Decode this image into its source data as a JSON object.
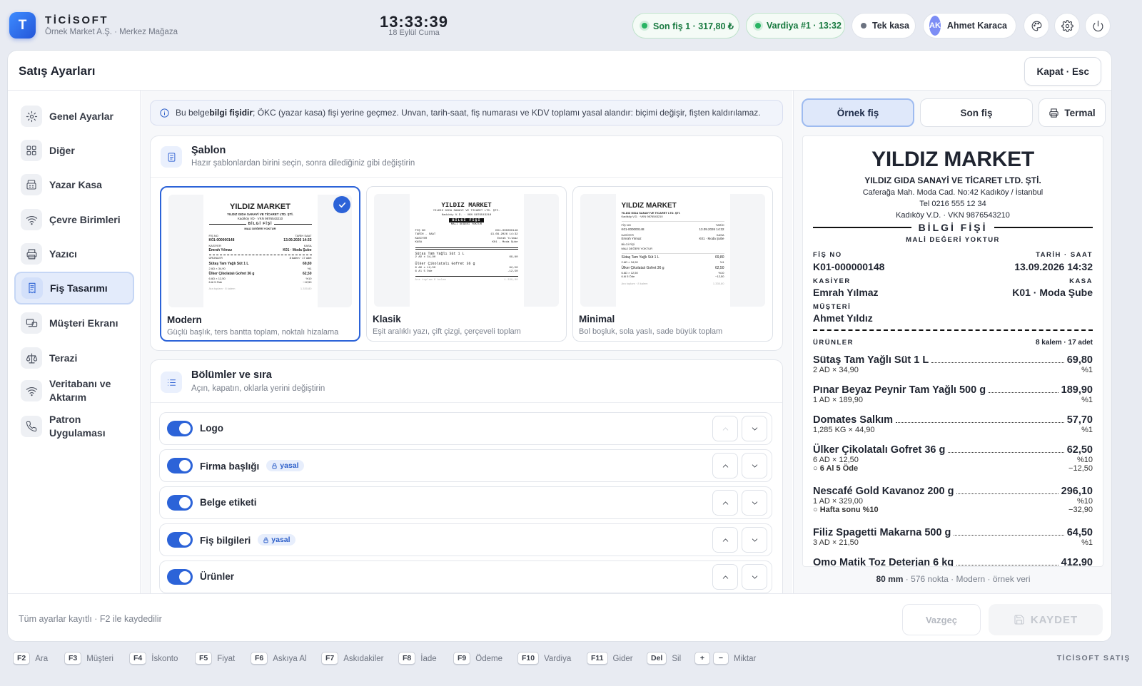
{
  "app": {
    "logo_letter": "T",
    "brand": "TİCİSOFT",
    "company": "Örnek Market A.Ş. · Merkez Mağaza",
    "clock": "13:33:39",
    "date": "18 Eylül Cuma"
  },
  "status": {
    "last_receipt": "Son fiş 1 · 317,80 ₺",
    "shift": "Vardiya #1 · 13:32",
    "register": "Tek kasa",
    "user_initials": "AK",
    "user_name": "Ahmet Karaca"
  },
  "panel": {
    "title": "Satış Ayarları",
    "close_label": "Kapat · Esc"
  },
  "sidebar": {
    "items": [
      {
        "label": "Genel Ayarlar",
        "icon": "gear-icon"
      },
      {
        "label": "Diğer",
        "icon": "grid-icon"
      },
      {
        "label": "Yazar Kasa",
        "icon": "cash-register-icon"
      },
      {
        "label": "Çevre Birimleri",
        "icon": "wifi-icon"
      },
      {
        "label": "Yazıcı",
        "icon": "printer-icon"
      },
      {
        "label": "Fiş Tasarımı",
        "icon": "receipt-icon",
        "active": true
      },
      {
        "label": "Müşteri Ekranı",
        "icon": "display-icon"
      },
      {
        "label": "Terazi",
        "icon": "scale-icon"
      },
      {
        "label": "Veritabanı ve Aktarım",
        "icon": "wifi-icon"
      },
      {
        "label": "Patron Uygulaması",
        "icon": "phone-icon"
      }
    ]
  },
  "info": {
    "pre": "Bu belge ",
    "bold": "bilgi fişidir",
    "post": "; ÖKC (yazar kasa) fişi yerine geçmez. Unvan, tarih-saat, fiş numarası ve KDV toplamı yasal alandır: biçimi değişir, fişten kaldırılamaz."
  },
  "template_card": {
    "title": "Şablon",
    "subtitle": "Hazır şablonlardan birini seçin, sonra dilediğiniz gibi değiştirin",
    "templates": [
      {
        "name": "Modern",
        "desc": "Güçlü başlık, ters bantta toplam, noktalı hizalama",
        "selected": true
      },
      {
        "name": "Klasik",
        "desc": "Eşit aralıklı yazı, çift çizgi, çerçeveli toplam",
        "selected": false
      },
      {
        "name": "Minimal",
        "desc": "Bol boşluk, sola yaslı, sade büyük toplam",
        "selected": false
      }
    ]
  },
  "sections_card": {
    "title": "Bölümler ve sıra",
    "subtitle": "Açın, kapatın, oklarla yerini değiştirin",
    "legal_badge": "yasal",
    "rows": [
      {
        "label": "Logo",
        "enabled": true,
        "legal": false
      },
      {
        "label": "Firma başlığı",
        "enabled": true,
        "legal": true
      },
      {
        "label": "Belge etiketi",
        "enabled": true,
        "legal": false
      },
      {
        "label": "Fiş bilgileri",
        "enabled": true,
        "legal": true
      },
      {
        "label": "Ürünler",
        "enabled": true,
        "legal": false
      }
    ]
  },
  "preview": {
    "tabs": [
      "Örnek fiş",
      "Son fiş",
      "Termal"
    ],
    "store": "YILDIZ MARKET",
    "legal_name": "YILDIZ GIDA SANAYİ VE TİCARET LTD. ŞTİ.",
    "address": "Caferağa Mah. Moda Cad. No:42 Kadıköy / İstanbul",
    "phone": "Tel 0216 555 12 34",
    "tax": "Kadıköy V.D. · VKN 9876543210",
    "doc_label": "BİLGİ FİŞİ",
    "doc_sub": "MALİ DEĞERİ YOKTUR",
    "receipt_no_label": "FİŞ NO",
    "receipt_no": "K01-000000148",
    "datetime_label": "TARİH · SAAT",
    "datetime": "13.09.2026  14:32",
    "cashier_label": "KASİYER",
    "cashier": "Emrah Yılmaz",
    "register_label": "KASA",
    "register": "K01 · Moda Şube",
    "customer_label": "MÜŞTERİ",
    "customer": "Ahmet Yıldız",
    "products_label": "ÜRÜNLER",
    "products_count": "8 kalem · 17 adet",
    "items": [
      {
        "name": "Sütaş Tam Yağlı Süt 1 L",
        "price": "69,80",
        "qty": "2 AD × 34,90",
        "vat": "%1"
      },
      {
        "name": "Pınar Beyaz Peynir Tam Yağlı 500 g",
        "price": "189,90",
        "qty": "1 AD × 189,90",
        "vat": "%1"
      },
      {
        "name": "Domates Salkım",
        "price": "57,70",
        "qty": "1,285 KG × 44,90",
        "vat": "%1"
      },
      {
        "name": "Ülker Çikolatalı Gofret 36 g",
        "price": "62,50",
        "qty": "6 AD × 12,50",
        "vat": "%10",
        "discount": "6 Al 5 Öde",
        "discount_amount": "−12,50"
      },
      {
        "name": "Nescafé Gold Kavanoz 200 g",
        "price": "296,10",
        "qty": "1 AD × 329,00",
        "vat": "%10",
        "discount": "Hafta sonu %10",
        "discount_amount": "−32,90"
      },
      {
        "name": "Filiz Spagetti Makarna 500 g",
        "price": "64,50",
        "qty": "3 AD × 21,50",
        "vat": "%1"
      },
      {
        "name": "Omo Matik Toz Deterjan 6 kg",
        "price": "412,90",
        "qty": "",
        "vat": ""
      }
    ],
    "footer_bold": "80 mm",
    "footer_rest": " · 576 nokta · Modern · örnek veri"
  },
  "thumbs": {
    "modern": {
      "store": "YILDIZ MARKET",
      "legal": "YILDIZ GIDA SANAYİ VE TİCARET LTD. ŞTİ.",
      "tax": "Kadıköy VD · VKN 9876543210",
      "label": "BİLGİ FİŞİ",
      "sub": "MALİ DEĞERİ YOKTUR",
      "no_l": "FİŞ NO",
      "no": "K01-000000148",
      "dt_l": "TARİH  SAAT",
      "dt": "13.09.2026  14:32",
      "ca_l": "KASİYER",
      "ca": "Emrah Yılmaz",
      "k_l": "KASA",
      "k": "K01 · Moda Şube",
      "pr": "ÜRÜNLER",
      "cnt": "8 kalem · 17 adet",
      "i1": "Sütaş Tam Yağlı Süt 1 L",
      "p1": "69,80",
      "q1": "2 AD × 34,90",
      "v1": "%1",
      "i2": "Ülker Çikolatalı Gofret 36 g",
      "p2": "62,50",
      "q2": "6 AD × 12,50",
      "v2": "%10",
      "d2": "6 Al 5 Öde",
      "da2": "−12,50",
      "t": "Ara toplam · 8 kalem",
      "ta": "1.330,80"
    },
    "classic": {
      "store": "YILDIZ MARKET",
      "legal": "YILDIZ GIDA SANAYİ VE TİCARET LTD. ŞTİ.",
      "tax": "Kadıköy V.D. · VKN 9876543210",
      "label": "BİLGİ FİŞİ",
      "sub": "MALİ DEĞERİ YOKTUR",
      "no_l": "FİŞ NO",
      "no": "K01-000000148",
      "dt_l": "TARİH - SAAT",
      "dt": "13.09.2026 14:32",
      "ca_l": "KASİYER",
      "ca": "Emrah Yılmaz",
      "k_l": "KASA",
      "k": "K01 - Moda Şube",
      "i1": "Sütaş Tam Yağlı Süt 1 L",
      "q1": "2 AD x 34,90",
      "p1": "69,80",
      "i2": "Ülker Çikolatalı Gofret 36 g",
      "q2": "6 AD x 12,50",
      "p2": "62,50",
      "d2": "6 Al 5 Öde",
      "da2": "-12,50",
      "t": "Ara toplam",
      "tq": "8 kalem",
      "ta": "1.330,80"
    },
    "minimal": {
      "store": "YILDIZ MARKET",
      "legal": "YILDIZ GIDA SANAYİ VE TİCARET LTD. ŞTİ.",
      "tax": "Kadıköy V.D. · VKN 9876543210",
      "no_l": "FİŞ NO",
      "no": "K01-000000148",
      "dt_l": "TARİH",
      "dt": "13.09.2026 14:32",
      "ca_l": "KASİYER",
      "ca": "Emrah Yılmaz",
      "k_l": "KASA",
      "k": "K01 · Moda Şube",
      "lab": "BİLGİ FİŞİ",
      "sub": "MALİ DEĞERİ YOKTUR",
      "i1": "Sütaş Tam Yağlı Süt 1 L",
      "p1": "69,80",
      "q1": "2 AD × 34,90",
      "v1": "%1",
      "i2": "Ülker Çikolatalı Gofret 36 g",
      "p2": "62,50",
      "q2": "6 AD × 12,50",
      "v2": "%10",
      "d2": "6 Al 5 Öde",
      "da2": "−12,50",
      "t": "Ara toplam · 8 kalem",
      "ta": "1.330,80"
    }
  },
  "footer": {
    "saved_text": "Tüm ayarlar kayıtlı · F2 ile kaydedilir",
    "cancel": "Vazgeç",
    "save": "KAYDET"
  },
  "shortcuts": [
    {
      "key": "F2",
      "label": "Ara"
    },
    {
      "key": "F3",
      "label": "Müşteri"
    },
    {
      "key": "F4",
      "label": "İskonto"
    },
    {
      "key": "F5",
      "label": "Fiyat"
    },
    {
      "key": "F6",
      "label": "Askıya Al"
    },
    {
      "key": "F7",
      "label": "Askıdakiler"
    },
    {
      "key": "F8",
      "label": "İade"
    },
    {
      "key": "F9",
      "label": "Ödeme"
    },
    {
      "key": "F10",
      "label": "Vardiya"
    },
    {
      "key": "F11",
      "label": "Gider"
    },
    {
      "key": "Del",
      "label": "Sil"
    },
    {
      "key": "+",
      "label": ""
    },
    {
      "key": "−",
      "label": "Miktar"
    }
  ],
  "footer_brand": "TİCİSOFT SATIŞ",
  "colors": {
    "accent": "#2c63d8",
    "success": "#28b463"
  }
}
